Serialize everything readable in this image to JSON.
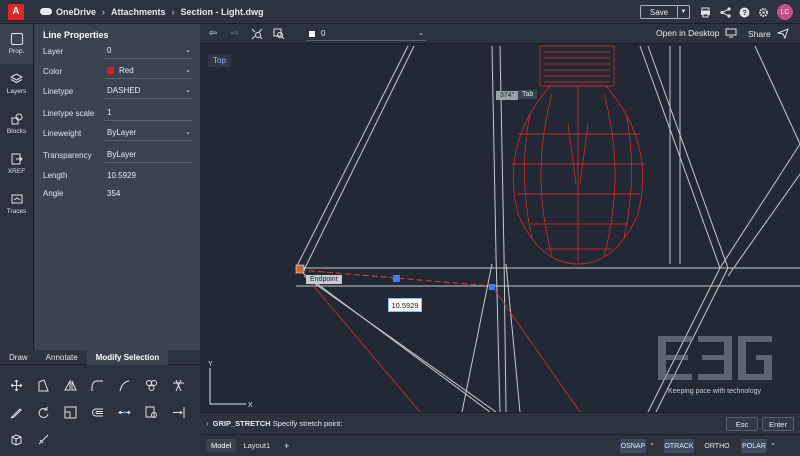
{
  "topbar": {
    "logo": "A",
    "breadcrumbs": [
      "OneDrive",
      "Attachments",
      "Section - Light.dwg"
    ],
    "save_label": "Save",
    "avatar_initials": "LC"
  },
  "rail": [
    {
      "label": "Prop.",
      "active": true
    },
    {
      "label": "Layers",
      "active": false
    },
    {
      "label": "Blocks",
      "active": false
    },
    {
      "label": "XREF",
      "active": false
    },
    {
      "label": "Traces",
      "active": false
    }
  ],
  "props": {
    "title": "Line Properties",
    "rows": [
      {
        "label": "Layer",
        "value": "0",
        "dropdown": true
      },
      {
        "label": "Color",
        "value": "Red",
        "dropdown": true,
        "swatch": "#e21c1c"
      },
      {
        "label": "Linetype",
        "value": "DASHED",
        "dropdown": true
      },
      {
        "label": "Linetype scale",
        "value": "1",
        "dropdown": false
      },
      {
        "label": "Lineweight",
        "value": "ByLayer",
        "dropdown": true
      },
      {
        "label": "Transparency",
        "value": "ByLayer",
        "dropdown": false
      },
      {
        "label": "Length",
        "value": "10.5929",
        "dropdown": false
      },
      {
        "label": "Angle",
        "value": "354",
        "dropdown": false
      }
    ]
  },
  "tools": {
    "tabs": [
      "Draw",
      "Annotate",
      "Modify Selection"
    ],
    "active_tab": "Modify Selection"
  },
  "canvas": {
    "layer_value": "0",
    "open_desktop": "Open in Desktop",
    "share": "Share",
    "view_label": "Top",
    "angle_tip": "374°",
    "tab_tip": "Tab",
    "endpoint_tip": "Endpoint",
    "dimension_value": "10.5929",
    "watermark_text": "Keeping pace with technology"
  },
  "command": {
    "name": "GRIP_STRETCH",
    "prompt": "Specify stretch point:",
    "esc": "Esc",
    "enter": "Enter"
  },
  "status": {
    "tabs": [
      "Model",
      "Layout1",
      "+"
    ],
    "toggles": [
      "OSNAP",
      "OTRACK",
      "ORTHO",
      "POLAR"
    ]
  },
  "colors": {
    "accent": "#e21c1c",
    "selection": "#3d7bff"
  }
}
